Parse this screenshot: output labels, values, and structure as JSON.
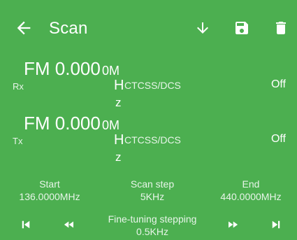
{
  "header": {
    "title": "Scan",
    "back_icon": "arrow-left-icon",
    "actions": [
      "download-icon",
      "save-icon",
      "delete-icon"
    ]
  },
  "rx": {
    "mode": "FM",
    "frequency": "0.000",
    "unit_prefix": "0M",
    "unit_h": "H",
    "unit_z": "z",
    "label": "Rx",
    "ctcss_label": "CTCSS/DCS",
    "ctcss_value": "Off"
  },
  "tx": {
    "mode": "FM",
    "frequency": "0.000",
    "unit_prefix": "0M",
    "unit_h": "H",
    "unit_z": "z",
    "label": "Tx",
    "ctcss_label": "CTCSS/DCS",
    "ctcss_value": "Off"
  },
  "scan": {
    "start_label": "Start",
    "start_value": "136.0000MHz",
    "step_label": "Scan step",
    "step_value": "5KHz",
    "end_label": "End",
    "end_value": "440.0000MHz"
  },
  "controls": {
    "fine_tune_label": "Fine-tuning stepping",
    "fine_tune_value": "0.5KHz",
    "icons": [
      "skip-first-icon",
      "rewind-icon",
      "fast-forward-icon",
      "skip-last-icon"
    ]
  },
  "colors": {
    "background": "#4caf50",
    "text": "#ffffff"
  }
}
